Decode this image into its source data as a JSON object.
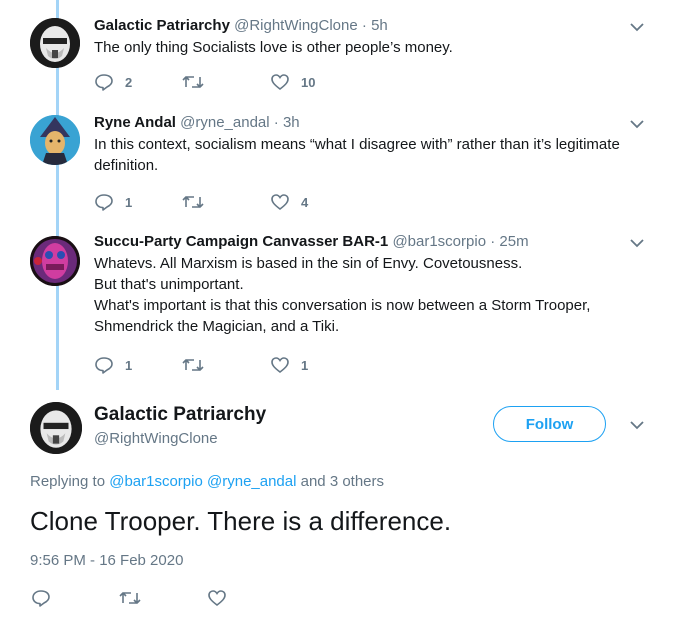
{
  "replies": [
    {
      "name": "Galactic Patriarchy",
      "handle": "@RightWingClone",
      "time": "5h",
      "avatar": "stormtrooper-avatar",
      "lines": [
        "The only thing Socialists love is other people’s money."
      ],
      "reply_count": "2",
      "retweet_count": "",
      "like_count": "10"
    },
    {
      "name": "Ryne Andal",
      "handle": "@ryne_andal",
      "time": "3h",
      "avatar": "wizard-avatar",
      "lines": [
        "In this context, socialism means “what I disagree with” rather than it’s legitimate",
        "definition."
      ],
      "reply_count": "1",
      "retweet_count": "",
      "like_count": "4"
    },
    {
      "name": "Succu-Party Campaign Canvasser BAR-1",
      "handle": "@bar1scorpio",
      "time": "25m",
      "avatar": "tiki-avatar",
      "lines": [
        "Whatevs. All Marxism is based in the sin of Envy. Covetousness.",
        "But that's unimportant.",
        "What's important is that this conversation is now between a Storm Trooper,",
        "Shmendrick the Magician, and a Tiki."
      ],
      "reply_count": "1",
      "retweet_count": "",
      "like_count": "1"
    }
  ],
  "main_tweet": {
    "name": "Galactic Patriarchy",
    "handle": "@RightWingClone",
    "follow_label": "Follow",
    "replying_prefix": "Replying to",
    "replying_to": [
      "@bar1scorpio",
      "@ryne_andal"
    ],
    "replying_suffix": "and 3 others",
    "text": "Clone Trooper. There is a difference.",
    "timestamp": "9:56 PM - 16 Feb 2020"
  },
  "colors": {
    "accent": "#1da1f2",
    "muted": "#657786",
    "thread_line": "#a3d4f7",
    "text": "#14171a"
  },
  "icons": [
    "reply-icon",
    "retweet-icon",
    "like-icon",
    "chevron-down-icon"
  ]
}
